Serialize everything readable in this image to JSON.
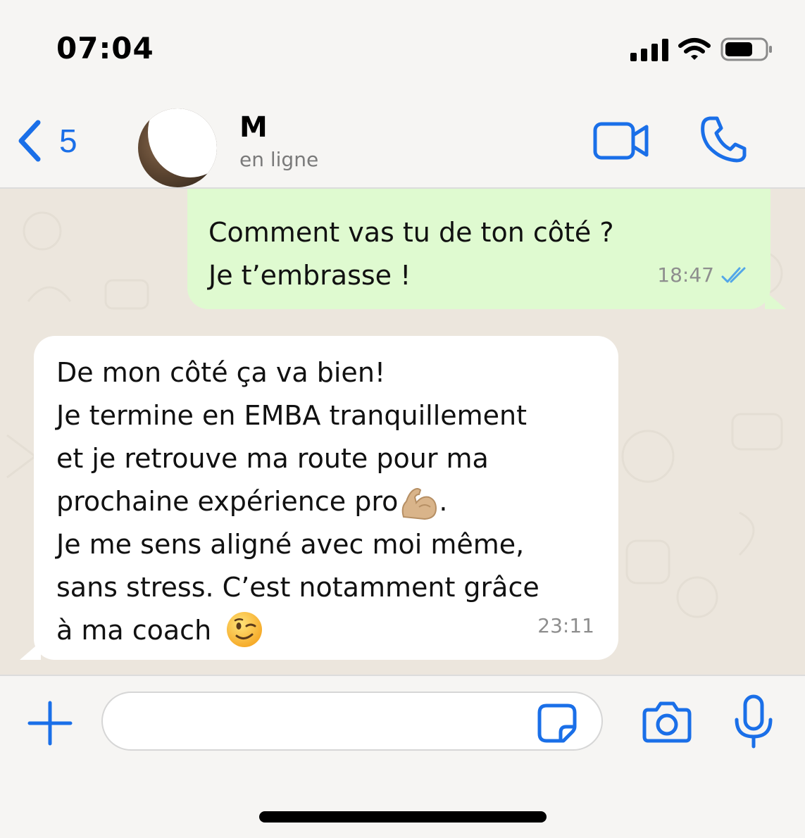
{
  "status_bar": {
    "time": "07:04",
    "icons": [
      "signal-icon",
      "wifi-icon",
      "battery-icon"
    ]
  },
  "header": {
    "back_count": "5",
    "contact_name": "M",
    "contact_status": "en ligne",
    "icons": [
      "chevron-left-icon",
      "video-call-icon",
      "phone-icon"
    ]
  },
  "messages": [
    {
      "direction": "outgoing",
      "lines": [
        "Comment vas tu de ton côté ?",
        "Je t’embrasse !"
      ],
      "time": "18:47",
      "read_receipt": "double-check-icon"
    },
    {
      "direction": "incoming",
      "lines": [
        "De mon côté ça va bien!",
        "Je termine en EMBA tranquillement",
        "et je retrouve ma route pour ma",
        "prochaine expérience pro",
        "Je me sens aligné avec moi même,",
        "sans stress. C’est notamment grâce",
        "à ma coach"
      ],
      "line4_suffix": ".",
      "emojis": [
        "flexed-biceps-emoji",
        "winking-face-emoji"
      ],
      "time": "23:11"
    }
  ],
  "input_bar": {
    "placeholder": "",
    "icons": [
      "plus-icon",
      "sticker-icon",
      "camera-icon",
      "microphone-icon"
    ]
  },
  "colors": {
    "accent": "#1a6fe8",
    "outgoing_bubble": "#dffad0",
    "incoming_bubble": "#ffffff",
    "chat_background": "#ece6dd",
    "read_receipt": "#53a6e8"
  }
}
